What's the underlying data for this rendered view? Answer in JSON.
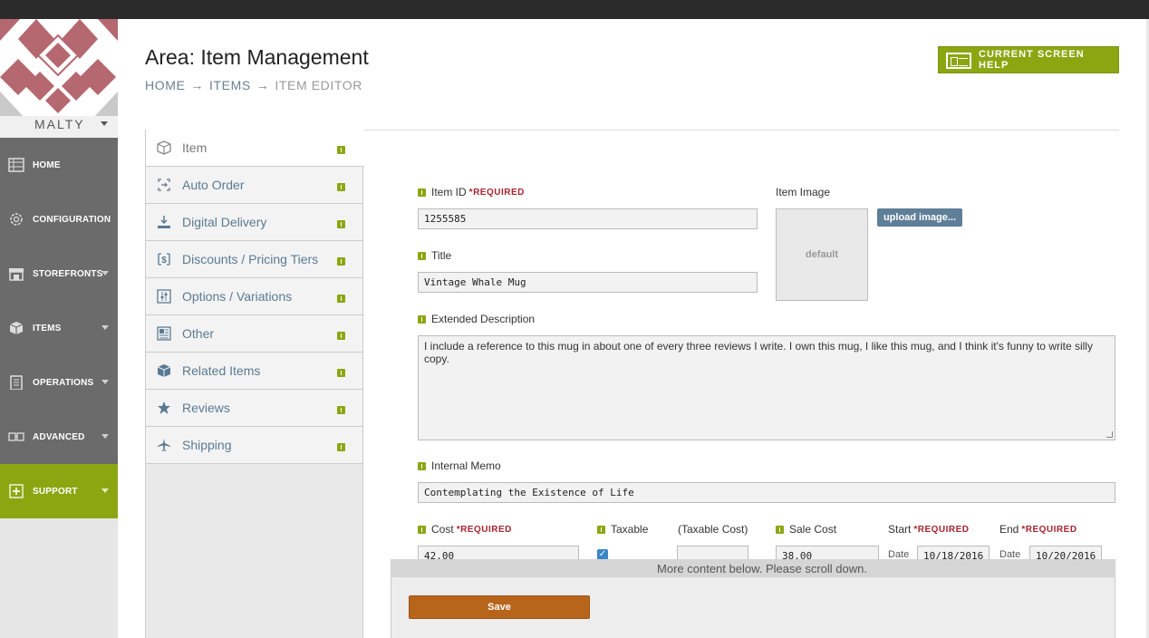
{
  "store": {
    "name": "MALTY"
  },
  "nav": {
    "items": [
      {
        "label": "HOME",
        "icon": "home-grid-icon"
      },
      {
        "label": "CONFIGURATION",
        "icon": "gear-icon"
      },
      {
        "label": "STOREFRONTS",
        "icon": "storefront-icon"
      },
      {
        "label": "ITEMS",
        "icon": "cube-icon"
      },
      {
        "label": "OPERATIONS",
        "icon": "clipboard-icon"
      },
      {
        "label": "ADVANCED",
        "icon": "advanced-icon"
      },
      {
        "label": "SUPPORT",
        "icon": "plus-icon"
      }
    ]
  },
  "header": {
    "title": "Area: Item Management",
    "breadcrumb": [
      "HOME",
      "ITEMS",
      "ITEM EDITOR"
    ],
    "arrow": "→",
    "help_label": "CURRENT SCREEN HELP"
  },
  "tabs": [
    {
      "label": "Item",
      "icon": "box-outline-icon",
      "active": true
    },
    {
      "label": "Auto Order",
      "icon": "auto-order-icon"
    },
    {
      "label": "Digital Delivery",
      "icon": "download-icon"
    },
    {
      "label": "Discounts / Pricing Tiers",
      "icon": "dollar-icon"
    },
    {
      "label": "Options / Variations",
      "icon": "sliders-icon"
    },
    {
      "label": "Other",
      "icon": "document-icon"
    },
    {
      "label": "Related Items",
      "icon": "cube-icon"
    },
    {
      "label": "Reviews",
      "icon": "star-icon"
    },
    {
      "label": "Shipping",
      "icon": "airplane-icon"
    }
  ],
  "form": {
    "required_marker": "*REQUIRED",
    "item_id": {
      "label": "Item ID",
      "value": "1255585"
    },
    "title": {
      "label": "Title",
      "value": "Vintage Whale Mug"
    },
    "item_image": {
      "label": "Item Image",
      "placeholder": "default",
      "upload_label": "upload image..."
    },
    "extended_description": {
      "label": "Extended Description",
      "value": "I include a reference to this mug in about one of every three reviews I write. I own this mug, I like this mug, and I think it's funny to write silly copy."
    },
    "internal_memo": {
      "label": "Internal Memo",
      "value": "Contemplating the Existence of Life"
    },
    "cost": {
      "label": "Cost",
      "value": "42.00"
    },
    "taxable": {
      "label": "Taxable",
      "checked": true
    },
    "taxable_cost": {
      "label": "(Taxable Cost)",
      "value": ""
    },
    "sale_cost": {
      "label": "Sale Cost",
      "value": "38.00"
    },
    "start": {
      "label": "Start",
      "date_label": "Date",
      "value": "10/18/2016"
    },
    "end": {
      "label": "End",
      "date_label": "Date",
      "value": "10/20/2016"
    }
  },
  "footer": {
    "scroll_notice": "More content below. Please scroll down.",
    "save_label": "Save"
  },
  "colors": {
    "nav_bg": "#6b6b6b",
    "accent_green": "#8aa712",
    "save_orange": "#b8651c",
    "required_red": "#a8252e",
    "link_blue": "#5a7a93"
  }
}
